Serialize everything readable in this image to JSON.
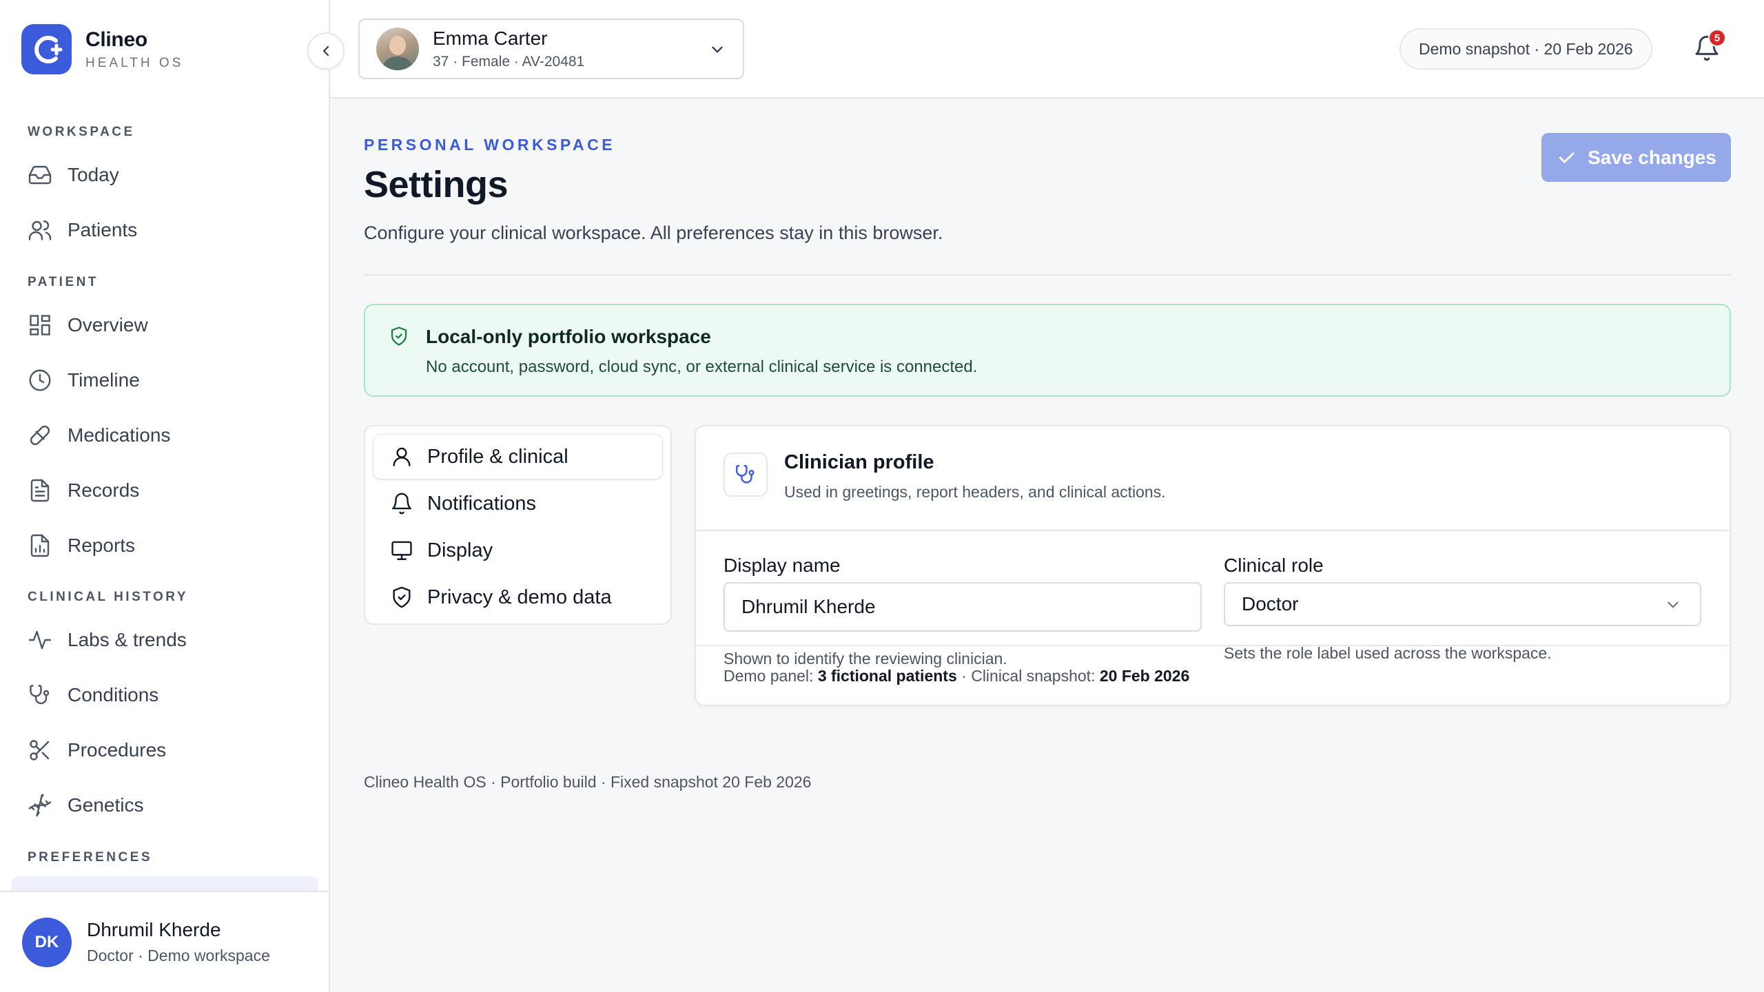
{
  "brand": {
    "name": "Clineo",
    "sub": "HEALTH OS",
    "accent": "#3b5bdb"
  },
  "sidebar": {
    "sections": [
      {
        "label": "WORKSPACE",
        "items": [
          {
            "label": "Today",
            "icon": "inbox-icon"
          },
          {
            "label": "Patients",
            "icon": "users-icon"
          }
        ]
      },
      {
        "label": "PATIENT",
        "items": [
          {
            "label": "Overview",
            "icon": "grid-icon"
          },
          {
            "label": "Timeline",
            "icon": "clock-icon"
          },
          {
            "label": "Medications",
            "icon": "pill-icon"
          },
          {
            "label": "Records",
            "icon": "file-text-icon"
          },
          {
            "label": "Reports",
            "icon": "file-chart-icon"
          }
        ]
      },
      {
        "label": "CLINICAL HISTORY",
        "items": [
          {
            "label": "Labs & trends",
            "icon": "activity-icon"
          },
          {
            "label": "Conditions",
            "icon": "stethoscope-icon"
          },
          {
            "label": "Procedures",
            "icon": "scissors-icon"
          },
          {
            "label": "Genetics",
            "icon": "dna-icon"
          }
        ]
      },
      {
        "label": "PREFERENCES",
        "items": []
      }
    ],
    "user": {
      "initials": "DK",
      "name": "Dhrumil Kherde",
      "role": "Doctor · Demo workspace"
    }
  },
  "topbar": {
    "patient": {
      "name": "Emma Carter",
      "meta": "37 · Female · AV-20481"
    },
    "snapshot": "Demo snapshot · 20 Feb 2026",
    "notifications_count": "5"
  },
  "page": {
    "eyebrow": "PERSONAL WORKSPACE",
    "title": "Settings",
    "description": "Configure your clinical workspace. All preferences stay in this browser.",
    "save_label": "Save changes"
  },
  "notice": {
    "title": "Local-only portfolio workspace",
    "text": "No account, password, cloud sync, or external clinical service is connected."
  },
  "tabs": [
    {
      "label": "Profile & clinical",
      "icon": "user-icon",
      "active": true
    },
    {
      "label": "Notifications",
      "icon": "bell-icon"
    },
    {
      "label": "Display",
      "icon": "monitor-icon"
    },
    {
      "label": "Privacy & demo data",
      "icon": "shield-check-icon"
    }
  ],
  "profile": {
    "title": "Clinician profile",
    "subtitle": "Used in greetings, report headers, and clinical actions.",
    "display_name_label": "Display name",
    "display_name_value": "Dhrumil Kherde",
    "display_name_help": "Shown to identify the reviewing clinician.",
    "role_label": "Clinical role",
    "role_value": "Doctor",
    "role_help": "Sets the role label used across the workspace.",
    "footer": {
      "panel_label": "Demo panel:",
      "panel_value": "3 fictional patients",
      "separator": " · ",
      "snapshot_label": "Clinical snapshot:",
      "snapshot_value": "20 Feb 2026"
    }
  },
  "app_footer": "Clineo Health OS · Portfolio build · Fixed snapshot 20 Feb 2026"
}
